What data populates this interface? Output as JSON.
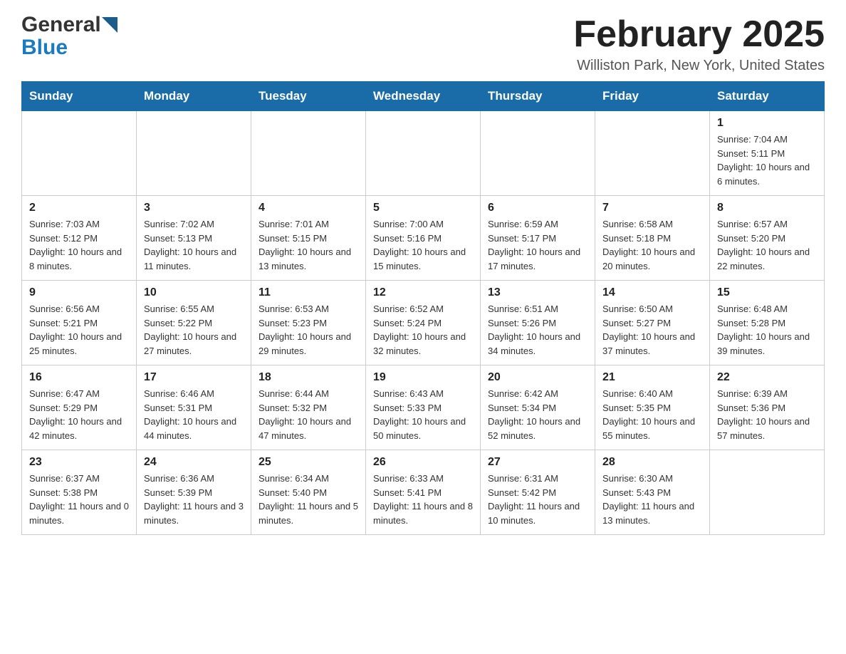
{
  "header": {
    "logo_general": "General",
    "logo_blue": "Blue",
    "title": "February 2025",
    "location": "Williston Park, New York, United States"
  },
  "days_of_week": [
    "Sunday",
    "Monday",
    "Tuesday",
    "Wednesday",
    "Thursday",
    "Friday",
    "Saturday"
  ],
  "weeks": [
    [
      {
        "day": "",
        "info": ""
      },
      {
        "day": "",
        "info": ""
      },
      {
        "day": "",
        "info": ""
      },
      {
        "day": "",
        "info": ""
      },
      {
        "day": "",
        "info": ""
      },
      {
        "day": "",
        "info": ""
      },
      {
        "day": "1",
        "info": "Sunrise: 7:04 AM\nSunset: 5:11 PM\nDaylight: 10 hours and 6 minutes."
      }
    ],
    [
      {
        "day": "2",
        "info": "Sunrise: 7:03 AM\nSunset: 5:12 PM\nDaylight: 10 hours and 8 minutes."
      },
      {
        "day": "3",
        "info": "Sunrise: 7:02 AM\nSunset: 5:13 PM\nDaylight: 10 hours and 11 minutes."
      },
      {
        "day": "4",
        "info": "Sunrise: 7:01 AM\nSunset: 5:15 PM\nDaylight: 10 hours and 13 minutes."
      },
      {
        "day": "5",
        "info": "Sunrise: 7:00 AM\nSunset: 5:16 PM\nDaylight: 10 hours and 15 minutes."
      },
      {
        "day": "6",
        "info": "Sunrise: 6:59 AM\nSunset: 5:17 PM\nDaylight: 10 hours and 17 minutes."
      },
      {
        "day": "7",
        "info": "Sunrise: 6:58 AM\nSunset: 5:18 PM\nDaylight: 10 hours and 20 minutes."
      },
      {
        "day": "8",
        "info": "Sunrise: 6:57 AM\nSunset: 5:20 PM\nDaylight: 10 hours and 22 minutes."
      }
    ],
    [
      {
        "day": "9",
        "info": "Sunrise: 6:56 AM\nSunset: 5:21 PM\nDaylight: 10 hours and 25 minutes."
      },
      {
        "day": "10",
        "info": "Sunrise: 6:55 AM\nSunset: 5:22 PM\nDaylight: 10 hours and 27 minutes."
      },
      {
        "day": "11",
        "info": "Sunrise: 6:53 AM\nSunset: 5:23 PM\nDaylight: 10 hours and 29 minutes."
      },
      {
        "day": "12",
        "info": "Sunrise: 6:52 AM\nSunset: 5:24 PM\nDaylight: 10 hours and 32 minutes."
      },
      {
        "day": "13",
        "info": "Sunrise: 6:51 AM\nSunset: 5:26 PM\nDaylight: 10 hours and 34 minutes."
      },
      {
        "day": "14",
        "info": "Sunrise: 6:50 AM\nSunset: 5:27 PM\nDaylight: 10 hours and 37 minutes."
      },
      {
        "day": "15",
        "info": "Sunrise: 6:48 AM\nSunset: 5:28 PM\nDaylight: 10 hours and 39 minutes."
      }
    ],
    [
      {
        "day": "16",
        "info": "Sunrise: 6:47 AM\nSunset: 5:29 PM\nDaylight: 10 hours and 42 minutes."
      },
      {
        "day": "17",
        "info": "Sunrise: 6:46 AM\nSunset: 5:31 PM\nDaylight: 10 hours and 44 minutes."
      },
      {
        "day": "18",
        "info": "Sunrise: 6:44 AM\nSunset: 5:32 PM\nDaylight: 10 hours and 47 minutes."
      },
      {
        "day": "19",
        "info": "Sunrise: 6:43 AM\nSunset: 5:33 PM\nDaylight: 10 hours and 50 minutes."
      },
      {
        "day": "20",
        "info": "Sunrise: 6:42 AM\nSunset: 5:34 PM\nDaylight: 10 hours and 52 minutes."
      },
      {
        "day": "21",
        "info": "Sunrise: 6:40 AM\nSunset: 5:35 PM\nDaylight: 10 hours and 55 minutes."
      },
      {
        "day": "22",
        "info": "Sunrise: 6:39 AM\nSunset: 5:36 PM\nDaylight: 10 hours and 57 minutes."
      }
    ],
    [
      {
        "day": "23",
        "info": "Sunrise: 6:37 AM\nSunset: 5:38 PM\nDaylight: 11 hours and 0 minutes."
      },
      {
        "day": "24",
        "info": "Sunrise: 6:36 AM\nSunset: 5:39 PM\nDaylight: 11 hours and 3 minutes."
      },
      {
        "day": "25",
        "info": "Sunrise: 6:34 AM\nSunset: 5:40 PM\nDaylight: 11 hours and 5 minutes."
      },
      {
        "day": "26",
        "info": "Sunrise: 6:33 AM\nSunset: 5:41 PM\nDaylight: 11 hours and 8 minutes."
      },
      {
        "day": "27",
        "info": "Sunrise: 6:31 AM\nSunset: 5:42 PM\nDaylight: 11 hours and 10 minutes."
      },
      {
        "day": "28",
        "info": "Sunrise: 6:30 AM\nSunset: 5:43 PM\nDaylight: 11 hours and 13 minutes."
      },
      {
        "day": "",
        "info": ""
      }
    ]
  ]
}
